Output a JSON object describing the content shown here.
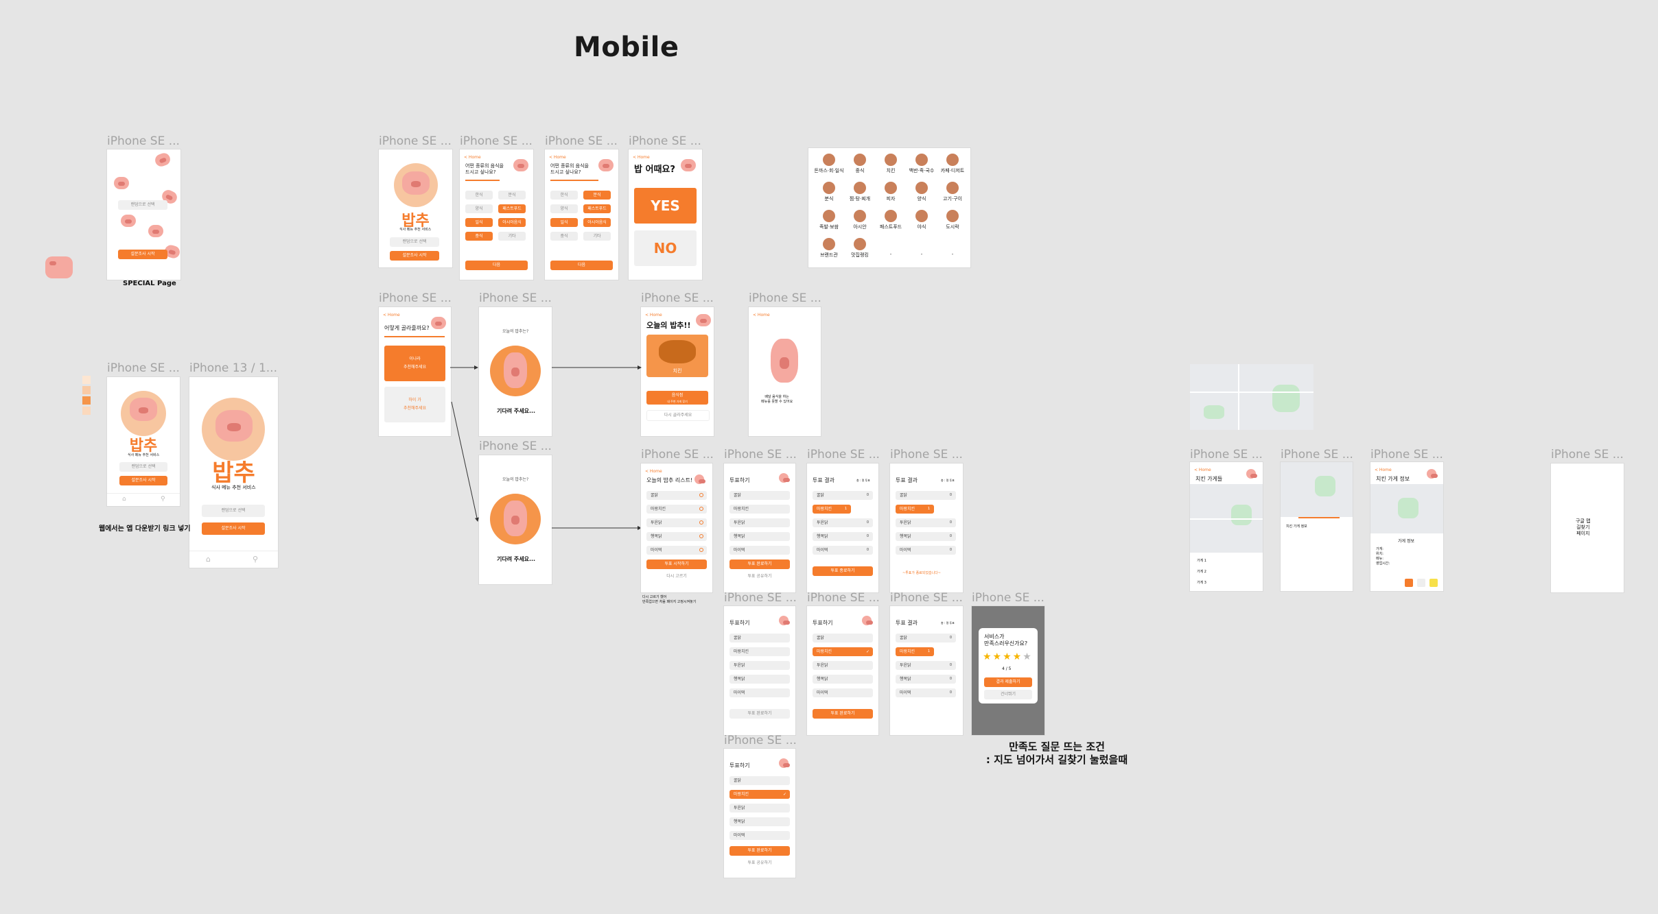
{
  "page_title": "Mobile",
  "frame_label_se": "iPhone SE ...",
  "frame_label_13": "iPhone 13 / 1...",
  "special_page_note": "SPECIAL Page",
  "download_note": "웹에서는 앱 다운받기 링크 넣기",
  "satisfaction_note": "만족도 질문 뜨는 조건\n: 지도 넘어가서 길찾기 눌렀을때",
  "colors": {
    "accent": "#f57c2c",
    "accent_light": "#f7c6a0",
    "pig": "#f5a9a0",
    "canvas": "#e5e5e5",
    "overlay": "#7a7a7a"
  },
  "common": {
    "back": "< Home",
    "next": "다음",
    "random_select": "랜덤으로 선택",
    "start_survey": "설문조사 시작",
    "logo_text": "밥추",
    "service_tagline": "식사 메뉴 추천 서비스"
  },
  "survey": {
    "question": "어떤 종류의 음식을\n드시고 싶나요?",
    "options": [
      "한식",
      "분식",
      "양식",
      "패스트푸드",
      "일식",
      "아시아음식",
      "중식",
      "기타"
    ]
  },
  "yesno": {
    "question": "밥 어때요?",
    "yes": "YES",
    "no": "NO"
  },
  "how_choose": {
    "question": "어떻게 골라줄까요?",
    "option_a": "이나라\n추천해주세요",
    "option_b": "하이 가\n추천해주세요"
  },
  "waiting": {
    "header": "오늘의 밥추는?",
    "wait_text": "기다려 주세요..."
  },
  "today": {
    "title": "오늘의 밥추!!",
    "menu_name": "치킨",
    "find_store": "음식점",
    "find_store_sub": "내 주변 가게 찾기",
    "retry": "다시 골라주세요"
  },
  "empty_state": {
    "text": "배달 음식을 하는\n메뉴를 못할 수 있어요"
  },
  "categories": [
    "돈까스·회·일식",
    "중식",
    "치킨",
    "백반·죽·국수",
    "카페·디저트",
    "분식",
    "찜·탕·찌개",
    "피자",
    "양식",
    "고기·구이",
    "족발·보쌈",
    "아시안",
    "패스트푸드",
    "야식",
    "도시락",
    "브랜드관",
    "맛집랭킹",
    "-",
    "-",
    "-"
  ],
  "list": {
    "title": "오늘의 밥추 리스트!",
    "items": [
      "꿀닭",
      "마왕치킨",
      "투윤닭",
      "행복닭",
      "마이떡"
    ],
    "vote": "투표 시작하기",
    "retry": "다시 고르기",
    "footnote": "다시 고르기 했어\n만족업으면 처음 페이지 고정시켜놓기"
  },
  "vote": {
    "title": "투표하기",
    "result_title": "투표 결과",
    "items": [
      "꿀닭",
      "마왕치킨",
      "투윤닭",
      "행복닭",
      "마이떡"
    ],
    "counts": [
      "0",
      "1",
      "0",
      "0",
      "0"
    ],
    "submit": "투표 완료하기",
    "share": "투표 공유하기",
    "end": "투표 종료하기",
    "count_label": "총 : 명 투표",
    "waiting": "~투표가 종료되었습니다~"
  },
  "rating": {
    "question": "서비스가\n만족스러우신가요?",
    "score": "4 / 5",
    "submit": "결과 제출하기",
    "skip": "건너뛰기"
  },
  "store": {
    "list_title": "치킨 가게들",
    "stores": [
      "가게 1",
      "가게 2",
      "가게 3"
    ],
    "detail_title": "치킨 가게 정보",
    "detail_subtitle": "가게 정보",
    "info_lines": "가게:\n위치:\n메뉴:\n영업시간:",
    "map_page": "구글 맵\n길찾기\n페이지"
  }
}
